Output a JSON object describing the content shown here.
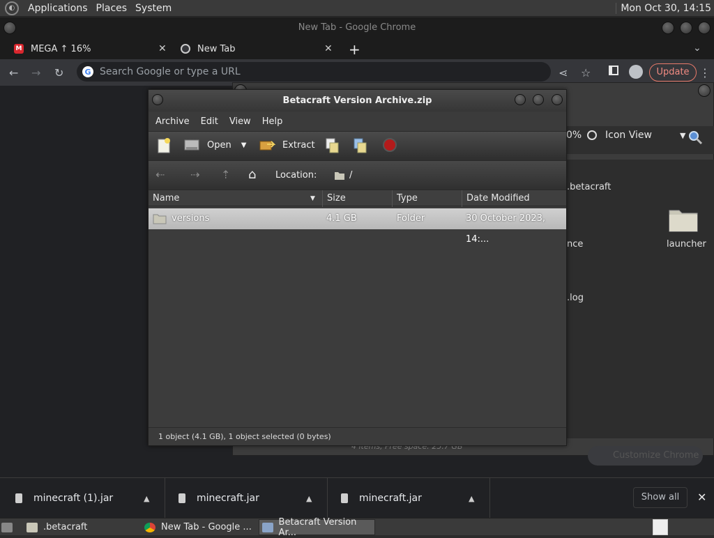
{
  "top_panel": {
    "menus": [
      "Applications",
      "Places",
      "System"
    ],
    "clock": "Mon Oct 30, 14:15"
  },
  "chrome": {
    "window_title": "New Tab - Google Chrome",
    "tabs": [
      {
        "label": "MEGA ↑ 16%",
        "favicon": "M"
      },
      {
        "label": "New Tab"
      }
    ],
    "omnibox_placeholder": "Search Google or type a URL",
    "update_label": "Update",
    "customize_label": "Customize Chrome"
  },
  "file_manager_bg": {
    "zoom": "0%",
    "view_mode": "Icon View",
    "partial_labels": [
      ".betacraft",
      "nce",
      "launcher",
      ".log"
    ],
    "status": "4 items, Free space: 25.7 GB"
  },
  "archive": {
    "title": "Betacraft Version Archive.zip",
    "menu": [
      "Archive",
      "Edit",
      "View",
      "Help"
    ],
    "toolbar": {
      "open": "Open",
      "extract": "Extract"
    },
    "location_label": "Location:",
    "location_path": "/",
    "columns": [
      "Name",
      "Size",
      "Type",
      "Date Modified"
    ],
    "rows": [
      {
        "name": "versions",
        "size": "4.1 GB",
        "type": "Folder",
        "modified": "30 October 2023, 14:..."
      }
    ],
    "status": "1 object (4.1 GB), 1 object selected (0 bytes)"
  },
  "downloads": {
    "items": [
      "minecraft (1).jar",
      "minecraft.jar",
      "minecraft.jar"
    ],
    "show_all": "Show all"
  },
  "taskbar": {
    "tasks": [
      ".betacraft",
      "New Tab - Google ...",
      "Betacraft Version Ar..."
    ]
  }
}
